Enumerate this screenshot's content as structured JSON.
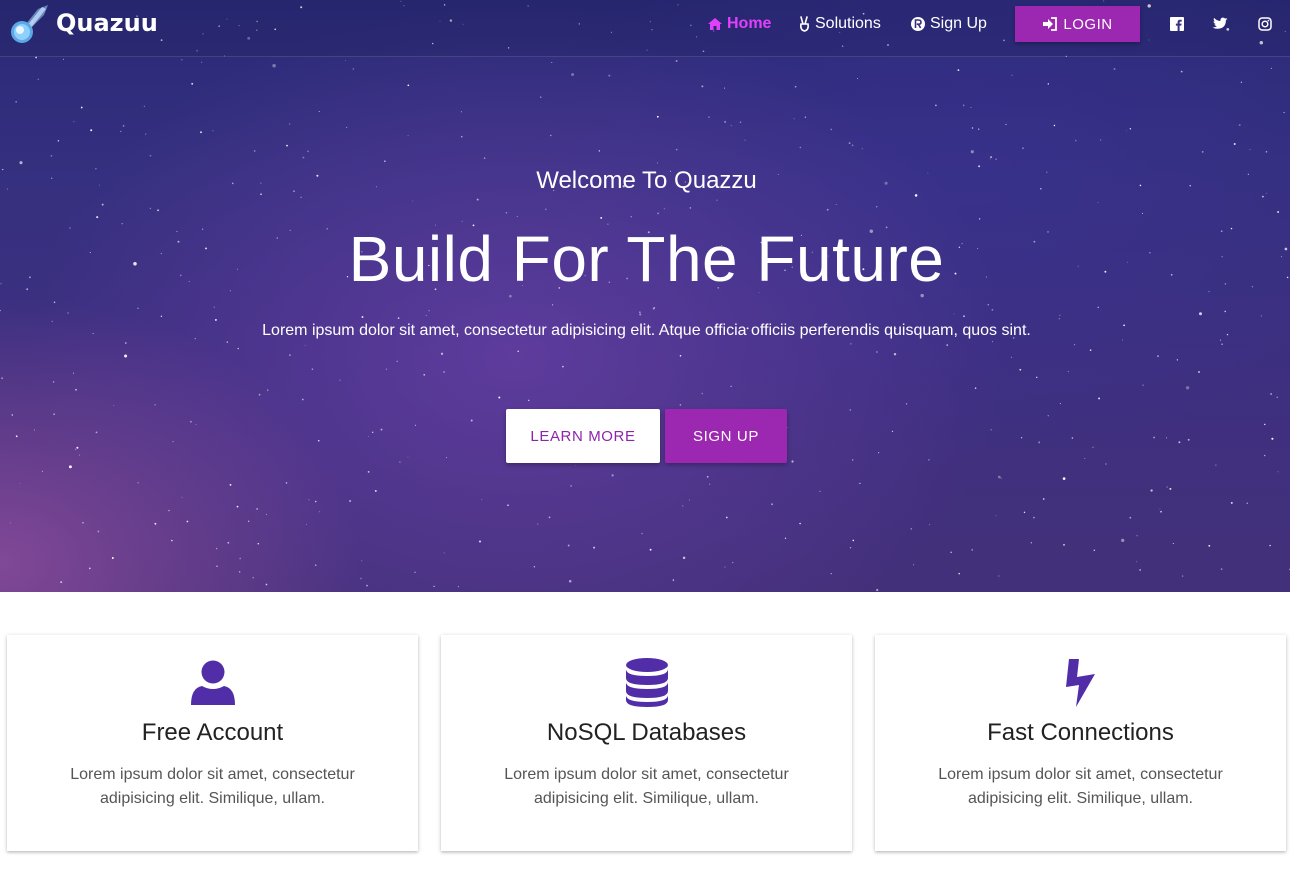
{
  "brand": {
    "name": "Quazuu",
    "logo_icon": "comet-icon"
  },
  "nav": {
    "items": [
      {
        "label": "Home",
        "icon": "home-icon",
        "active": true
      },
      {
        "label": "Solutions",
        "icon": "peace-hand-icon",
        "active": false
      },
      {
        "label": "Sign Up",
        "icon": "registered-icon",
        "active": false
      }
    ],
    "login_label": "LOGIN",
    "login_icon": "sign-in-icon",
    "social": [
      "facebook-icon",
      "twitter-icon",
      "instagram-icon"
    ]
  },
  "hero": {
    "subtitle": "Welcome To Quazzu",
    "title": "Build For The Future",
    "text": "Lorem ipsum dolor sit amet, consectetur adipisicing elit. Atque officia officiis perferendis quisquam, quos sint.",
    "learn_more_label": "LEARN MORE",
    "signup_label": "SIGN UP"
  },
  "features": [
    {
      "icon": "user-icon",
      "title": "Free Account",
      "text": "Lorem ipsum dolor sit amet, consectetur adipisicing elit. Similique, ullam."
    },
    {
      "icon": "database-icon",
      "title": "NoSQL Databases",
      "text": "Lorem ipsum dolor sit amet, consectetur adipisicing elit. Similique, ullam."
    },
    {
      "icon": "bolt-icon",
      "title": "Fast Connections",
      "text": "Lorem ipsum dolor sit amet, consectetur adipisicing elit. Similique, ullam."
    }
  ],
  "colors": {
    "accent": "#9c27b0",
    "active_nav": "#e040fb",
    "feature_icon": "#512da8",
    "hero_bg": "#35307f"
  }
}
